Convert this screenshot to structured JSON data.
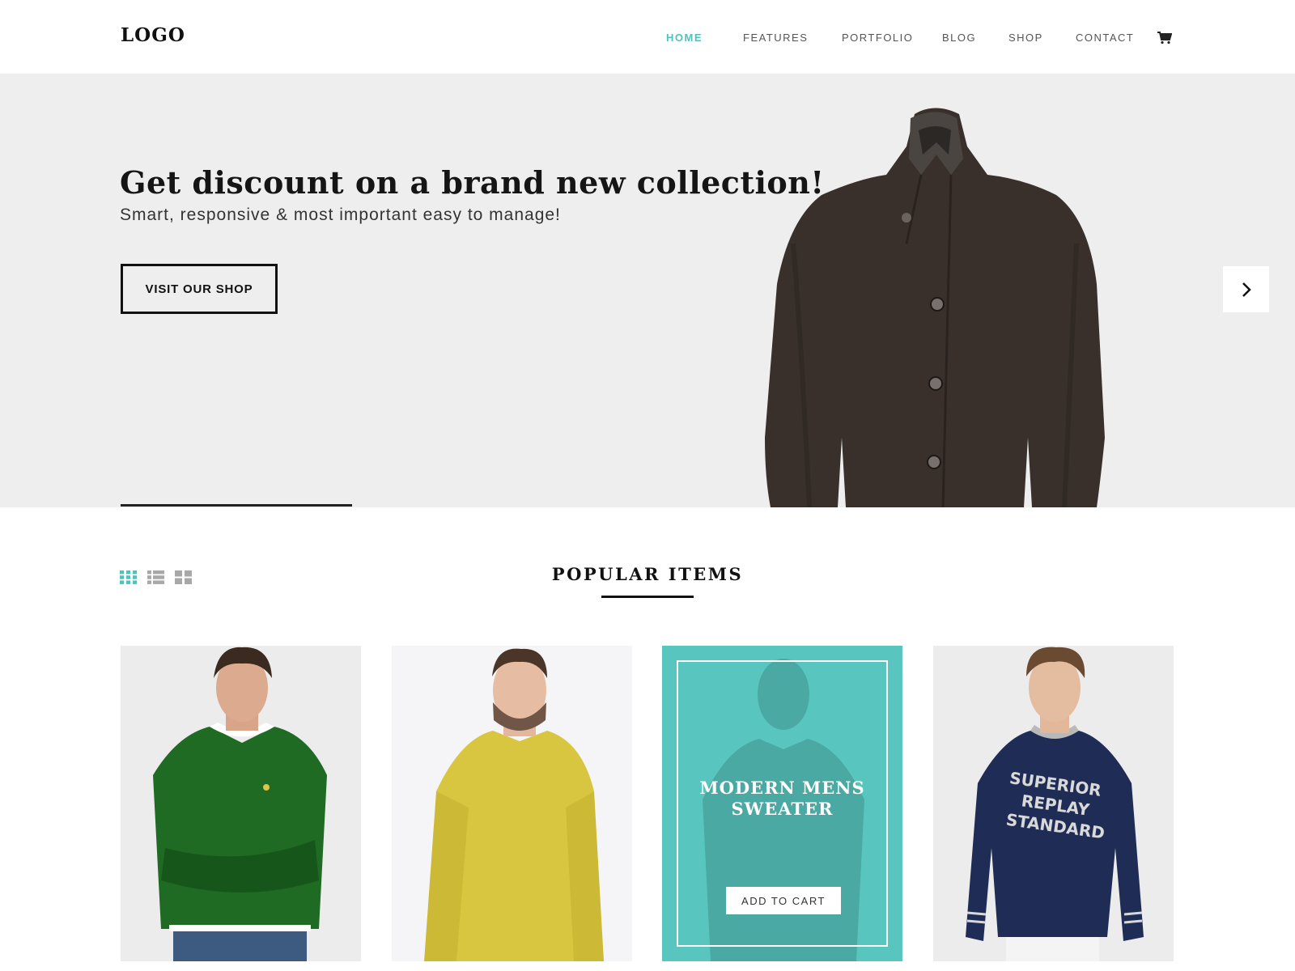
{
  "header": {
    "logo": "LOGO",
    "nav": [
      {
        "label": "HOME",
        "active": true
      },
      {
        "label": "FEATURES"
      },
      {
        "label": "PORTFOLIO"
      },
      {
        "label": "BLOG"
      },
      {
        "label": "SHOP"
      },
      {
        "label": "CONTACT"
      }
    ],
    "cart_icon": "shopping-cart-icon"
  },
  "hero": {
    "title": "Get discount on a brand new collection!",
    "subtitle": "Smart, responsive &  most important easy to manage!",
    "cta_label": "VISIT OUR SHOP",
    "next_icon": "chevron-right-icon",
    "background_color": "#eeeeee"
  },
  "popular": {
    "title": "POPULAR ITEMS",
    "view_icons": [
      "grid-view-icon",
      "list-view-icon",
      "large-grid-view-icon"
    ],
    "products": [
      {
        "image": "green-sweater-photo"
      },
      {
        "image": "yellow-sweater-photo"
      },
      {
        "image": "black-tshirt-photo",
        "name": "MODERN MENS\nSWEATER",
        "cta_label": "ADD TO CART"
      },
      {
        "image": "navy-sweatshirt-photo",
        "print": "SUPERIOR REPLAY STANDARD"
      }
    ]
  },
  "colors": {
    "accent": "#4fc3bb",
    "featured_overlay": "#58c6be"
  }
}
